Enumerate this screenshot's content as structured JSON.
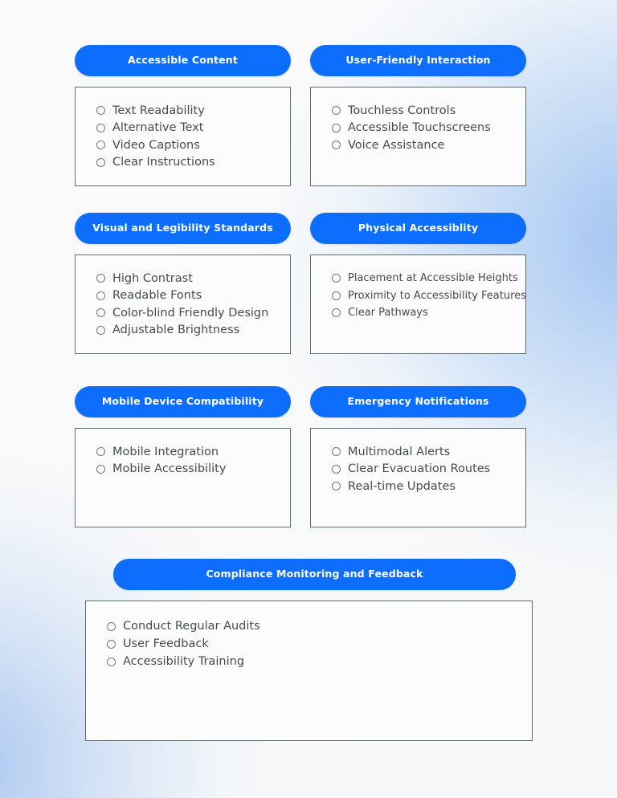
{
  "theme": {
    "accent_color": "#0d6efd",
    "card_border_color": "#5d6f6d",
    "card_background": "#fcfcfc",
    "item_text_color": "#444c4c",
    "page_background": "#f7f8f9"
  },
  "icons": {
    "radio": "radio-circle-icon"
  },
  "sections": [
    {
      "id": "accessible-content",
      "title": "Accessible Content",
      "items": [
        "Text Readability",
        "Alternative Text",
        "Video Captions",
        "Clear Instructions"
      ]
    },
    {
      "id": "user-friendly-interaction",
      "title": "User-Friendly Interaction",
      "items": [
        "Touchless Controls",
        "Accessible Touchscreens",
        "Voice Assistance"
      ]
    },
    {
      "id": "visual-and-legibility-standards",
      "title": "Visual and Legibility Standards",
      "items": [
        "High Contrast",
        "Readable Fonts",
        "Color-blind Friendly Design",
        "Adjustable Brightness"
      ]
    },
    {
      "id": "physical-accessiblity",
      "title": "Physical Accessiblity",
      "items": [
        "Placement at Accessible Heights",
        "Proximity to Accessibility Features",
        "Clear Pathways"
      ]
    },
    {
      "id": "mobile-device-compatibility",
      "title": "Mobile Device Compatibility",
      "items": [
        "Mobile Integration",
        "Mobile Accessibility"
      ]
    },
    {
      "id": "emergency-notifications",
      "title": "Emergency Notifications",
      "items": [
        "Multimodal Alerts",
        "Clear Evacuation Routes",
        "Real-time Updates"
      ]
    },
    {
      "id": "compliance-monitoring-and-feedback",
      "title": "Compliance Monitoring and Feedback",
      "items": [
        "Conduct Regular Audits",
        "User Feedback",
        "Accessibility Training"
      ]
    }
  ]
}
